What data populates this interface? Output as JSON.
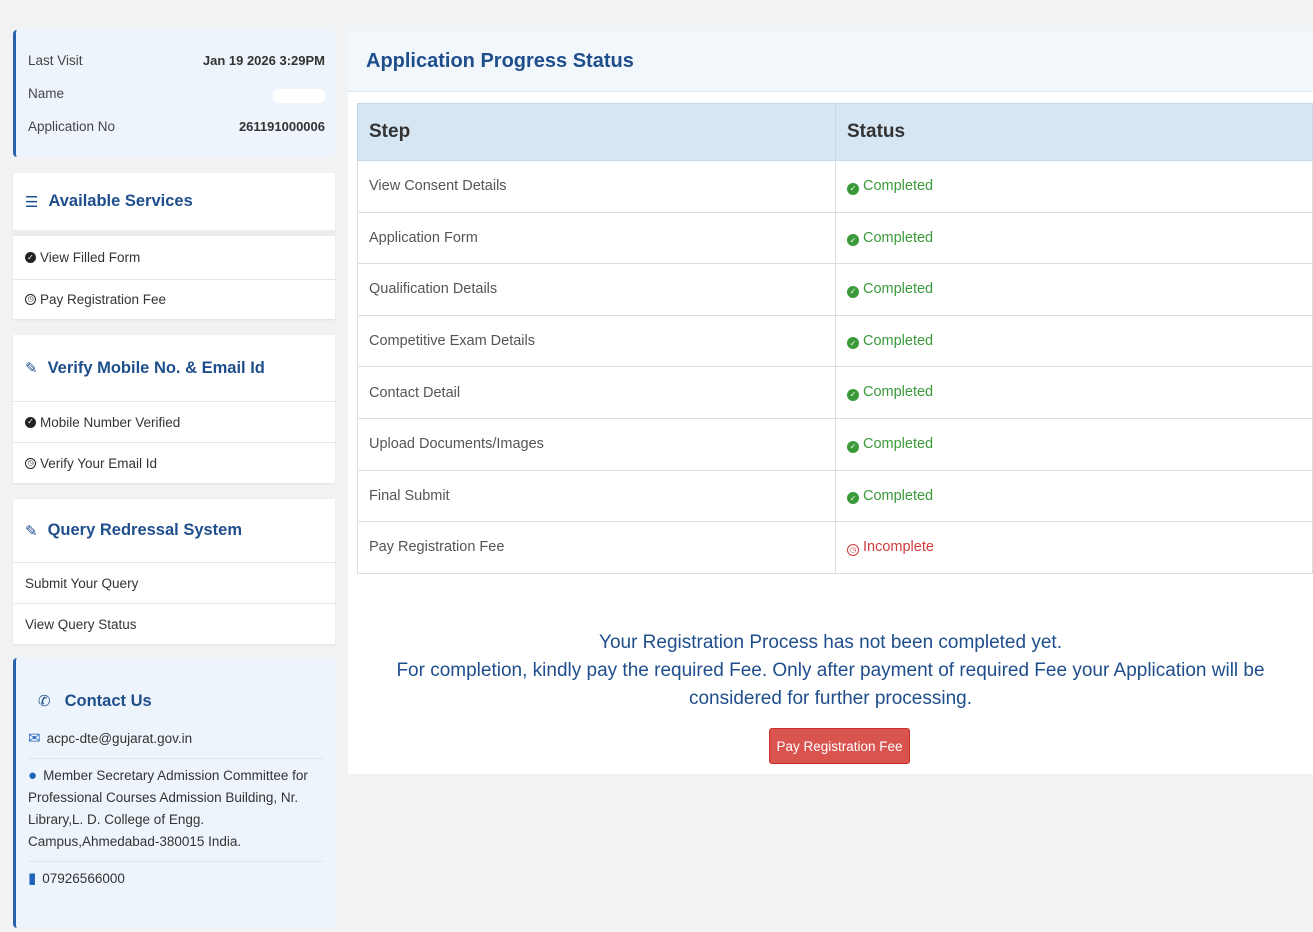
{
  "visit": {
    "last_visit_label": "Last Visit",
    "last_visit_value": "Jan 19 2026 3:29PM",
    "name_label": "Name",
    "app_no_label": "Application No",
    "app_no_value": "261191000006"
  },
  "services": {
    "title": "Available Services",
    "items": [
      {
        "label": "View Filled Form",
        "icon": "check-circle-icon"
      },
      {
        "label": "Pay Registration Fee",
        "icon": "clock-icon"
      }
    ]
  },
  "verify": {
    "title": "Verify Mobile No. & Email Id",
    "items": [
      {
        "label": "Mobile Number Verified",
        "icon": "check-circle-icon"
      },
      {
        "label": "Verify Your Email Id",
        "icon": "clock-icon"
      }
    ]
  },
  "query": {
    "title": "Query Redressal System",
    "items": [
      {
        "label": "Submit Your Query"
      },
      {
        "label": "View Query Status"
      }
    ]
  },
  "contact": {
    "title": "Contact Us",
    "email": "acpc-dte@gujarat.gov.in",
    "address": "Member Secretary Admission Committee for Professional Courses Admission Building, Nr. Library,L. D. College of Engg. Campus,Ahmedabad-380015 India.",
    "phone": "07926566000"
  },
  "progress": {
    "title": "Application Progress Status",
    "col_step": "Step",
    "col_status": "Status",
    "rows": [
      {
        "step": "View Consent Details",
        "status": "Completed"
      },
      {
        "step": "Application Form",
        "status": "Completed"
      },
      {
        "step": "Qualification Details",
        "status": "Completed"
      },
      {
        "step": "Competitive Exam Details",
        "status": "Completed"
      },
      {
        "step": "Contact Detail",
        "status": "Completed"
      },
      {
        "step": "Upload Documents/Images",
        "status": "Completed"
      },
      {
        "step": "Final Submit",
        "status": "Completed"
      },
      {
        "step": "Pay Registration Fee",
        "status": "Incomplete"
      }
    ]
  },
  "message": {
    "line1": "Your Registration Process has not been completed yet.",
    "line2": "For completion, kindly pay the required Fee. Only after payment of required Fee your Application will be considered for further processing."
  },
  "pay_button_label": "Pay Registration Fee",
  "colors": {
    "accent": "#1f4e8c",
    "completed": "#3a9a3a",
    "incomplete": "#d23b3b",
    "button": "#d9534f"
  }
}
